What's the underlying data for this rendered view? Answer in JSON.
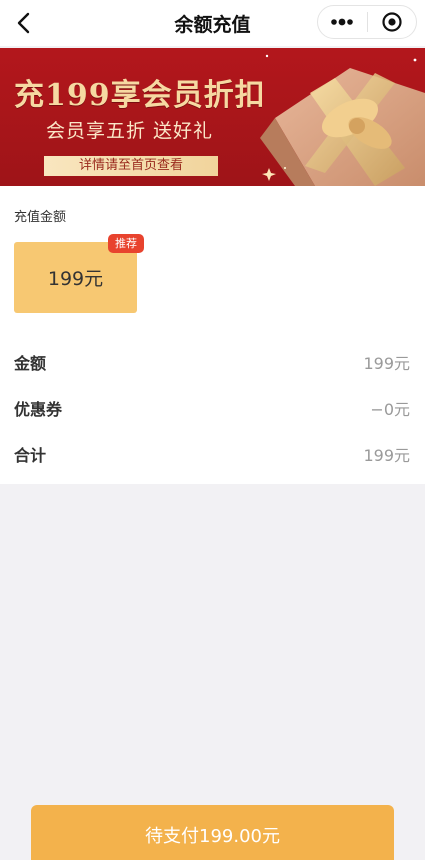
{
  "nav": {
    "title": "余额充值",
    "back_icon": "chevron-left-icon",
    "more_icon": "more-dots-icon",
    "close_icon": "target-circle-icon"
  },
  "banner": {
    "headline": "充199享会员折扣",
    "subtitle": "会员享五折 送好礼",
    "note": "详情请至首页查看",
    "colors": {
      "background": "#b3171c",
      "headline": "#f6d9a2"
    }
  },
  "recharge": {
    "section_label": "充值金额",
    "options": [
      {
        "label": "199元",
        "badge": "推荐",
        "selected": true
      }
    ]
  },
  "summary": {
    "rows": [
      {
        "label": "金额",
        "value": "199元"
      },
      {
        "label": "优惠券",
        "value": "−0元"
      },
      {
        "label": "合计",
        "value": "199元"
      }
    ]
  },
  "pay_button": {
    "label": "待支付199.00元",
    "color": "#f3b24c"
  }
}
